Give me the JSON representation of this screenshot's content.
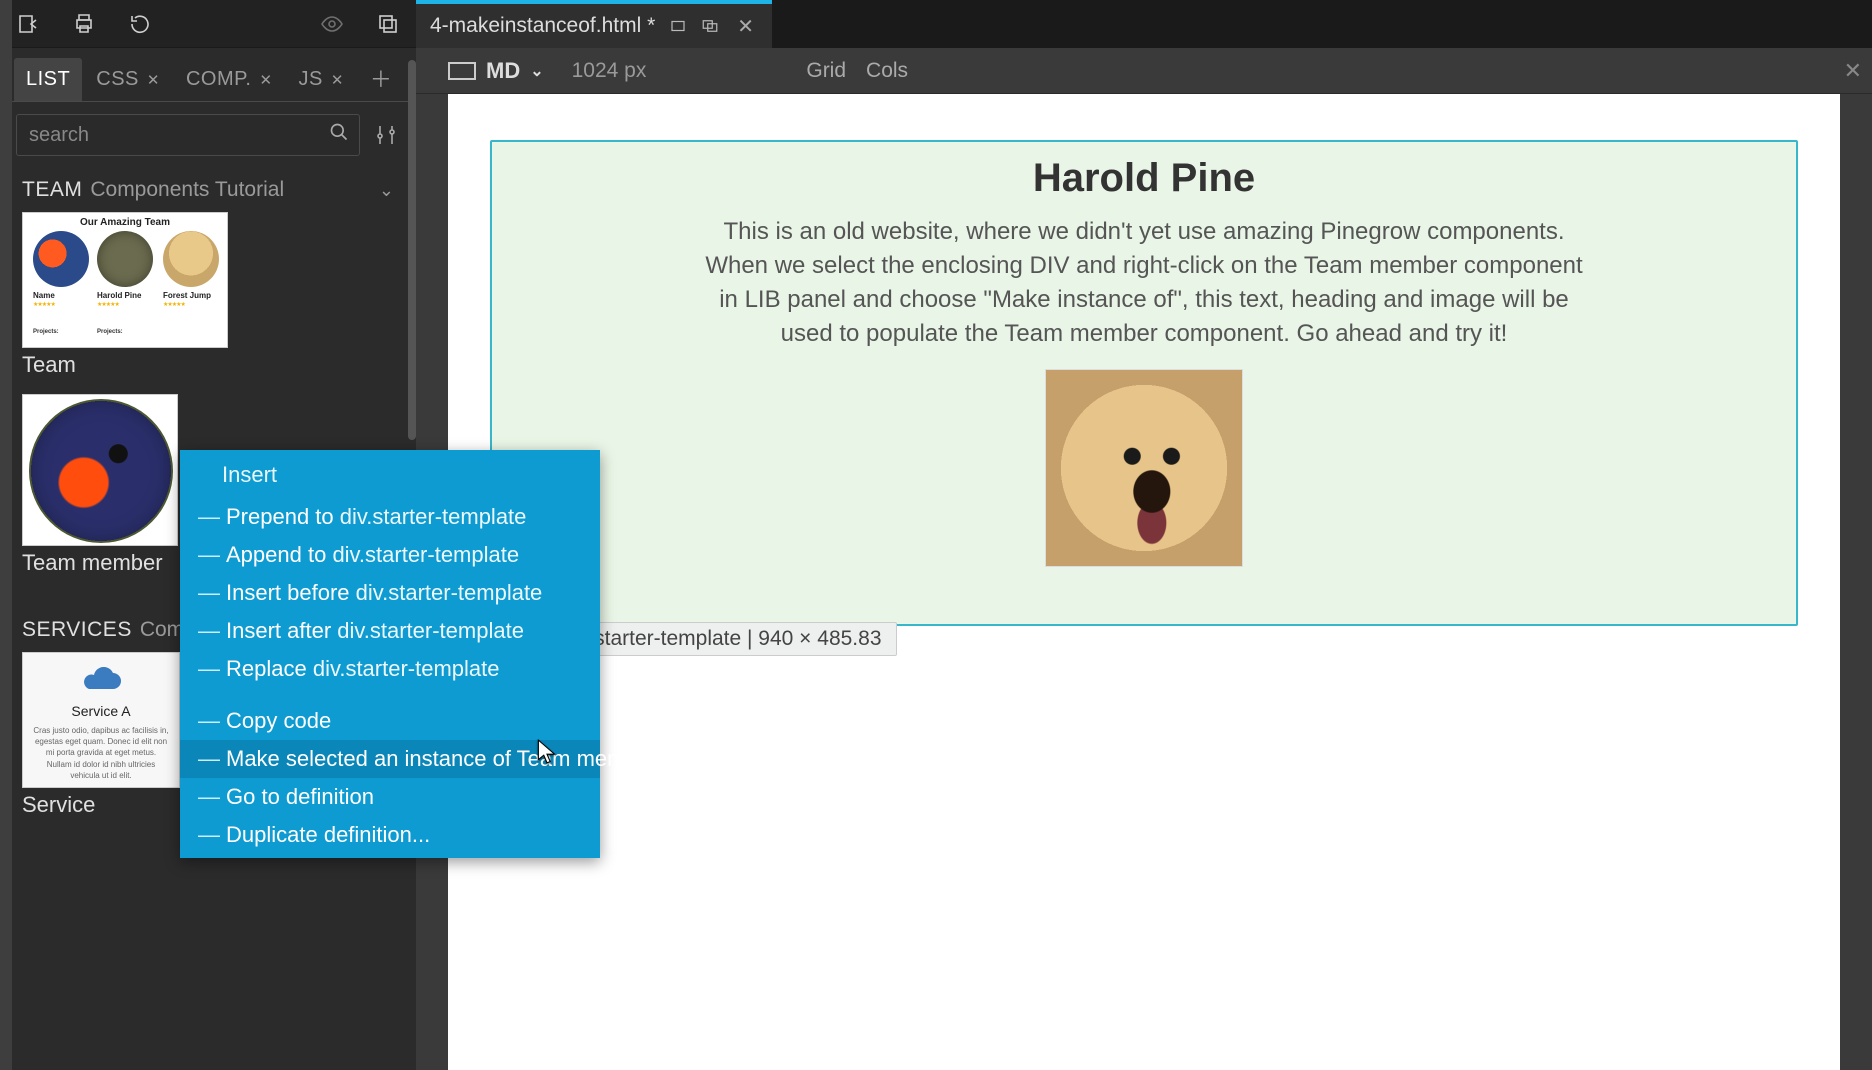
{
  "toolbar": {
    "icons": [
      "import-icon",
      "print-icon",
      "rotate-icon",
      "eye-icon",
      "copy-icon"
    ]
  },
  "lib_tabs": {
    "items": [
      {
        "label": "LIST",
        "active": true,
        "closable": false
      },
      {
        "label": "CSS",
        "active": false,
        "closable": true
      },
      {
        "label": "COMP.",
        "active": false,
        "closable": true
      },
      {
        "label": "JS",
        "active": false,
        "closable": true
      }
    ]
  },
  "search": {
    "placeholder": "search"
  },
  "sections": {
    "team": {
      "name": "TEAM",
      "sub": "Components Tutorial",
      "items": [
        {
          "label": "Team",
          "thumb": {
            "title": "Our Amazing Team",
            "names": [
              "Name",
              "Harold Pine",
              "Forest Jump"
            ],
            "proj": "Projects:"
          }
        },
        {
          "label": "Team member"
        }
      ]
    },
    "services": {
      "name": "SERVICES",
      "sub": "Compone",
      "items": [
        {
          "label": "Service",
          "thumb": {
            "title": "Service A",
            "desc": "Cras justo odio, dapibus ac facilisis in, egestas eget quam. Donec id elit non mi porta gravida at eget metus. Nullam id dolor id nibh ultricies vehicula ut id elit."
          }
        }
      ]
    }
  },
  "file_tab": {
    "title": "4-makeinstanceof.html *"
  },
  "breakpoint_bar": {
    "bp": "MD",
    "size": "1024 px",
    "grid": "Grid",
    "cols": "Cols"
  },
  "document": {
    "heading": "Harold Pine",
    "paragraph": "This is an old website, where we didn't yet use amazing Pinegrow components. When we select the enclosing DIV and right-click on the Team member component in LIB panel and choose \"Make instance of\", this text, heading and image will be used to populate the Team member component. Go ahead and try it!"
  },
  "selection_badge": {
    "prefix": "div.starter-template",
    "sep": " | ",
    "dims": "940 × 485.83"
  },
  "context_menu": {
    "header": "Insert",
    "items": [
      {
        "action": "Prepend to ",
        "target": "div.starter-template"
      },
      {
        "action": "Append to ",
        "target": "div.starter-template"
      },
      {
        "action": "Insert before ",
        "target": "div.starter-template"
      },
      {
        "action": "Insert after ",
        "target": "div.starter-template"
      },
      {
        "action": "Replace ",
        "target": "div.starter-template"
      }
    ],
    "items2": [
      {
        "action": "Copy code"
      },
      {
        "action": "Make selected an instance of Team member",
        "hovered": true
      },
      {
        "action": "Go to definition"
      },
      {
        "action": "Duplicate definition..."
      }
    ]
  }
}
